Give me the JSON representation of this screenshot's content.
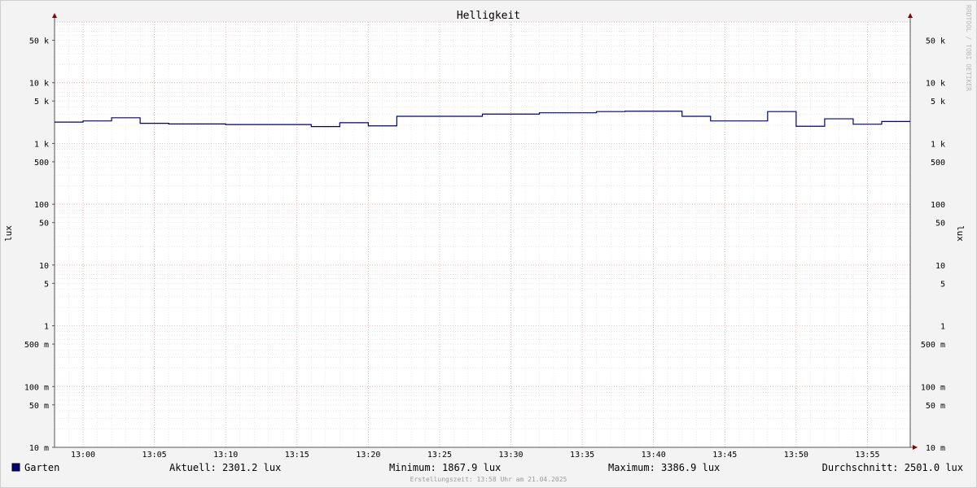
{
  "chart_data": {
    "type": "line",
    "title": "Helligkeit",
    "ylabel": "lux",
    "yscale": "log",
    "ylim": [
      0.01,
      100000
    ],
    "grid": true,
    "y_ticks": [
      {
        "value": 50000,
        "label": "50 k"
      },
      {
        "value": 10000,
        "label": "10 k"
      },
      {
        "value": 5000,
        "label": "5 k"
      },
      {
        "value": 1000,
        "label": "1 k"
      },
      {
        "value": 500,
        "label": "500"
      },
      {
        "value": 100,
        "label": "100"
      },
      {
        "value": 50,
        "label": "50"
      },
      {
        "value": 10,
        "label": "10"
      },
      {
        "value": 5,
        "label": "5"
      },
      {
        "value": 1,
        "label": "1"
      },
      {
        "value": 0.5,
        "label": "500 m"
      },
      {
        "value": 0.1,
        "label": "100 m"
      },
      {
        "value": 0.05,
        "label": "50 m"
      },
      {
        "value": 0.01,
        "label": "10 m"
      }
    ],
    "x_ticks": [
      "13:00",
      "13:05",
      "13:10",
      "13:15",
      "13:20",
      "13:25",
      "13:30",
      "13:35",
      "13:40",
      "13:45",
      "13:50",
      "13:55"
    ],
    "series": [
      {
        "name": "Garten",
        "color": "#000080",
        "points": [
          [
            "12:58",
            2250
          ],
          [
            "13:00",
            2350
          ],
          [
            "13:02",
            2650
          ],
          [
            "13:04",
            2150
          ],
          [
            "13:06",
            2100
          ],
          [
            "13:10",
            2050
          ],
          [
            "13:16",
            1900
          ],
          [
            "13:18",
            2200
          ],
          [
            "13:20",
            1950
          ],
          [
            "13:22",
            2800
          ],
          [
            "13:28",
            3050
          ],
          [
            "13:32",
            3200
          ],
          [
            "13:36",
            3350
          ],
          [
            "13:38",
            3400
          ],
          [
            "13:42",
            2800
          ],
          [
            "13:44",
            2350
          ],
          [
            "13:48",
            3350
          ],
          [
            "13:50",
            1920
          ],
          [
            "13:52",
            2550
          ],
          [
            "13:54",
            2080
          ],
          [
            "13:56",
            2300
          ],
          [
            "13:58",
            2300
          ]
        ]
      }
    ]
  },
  "legend": {
    "series_name": "Garten",
    "swatch_color": "#000080",
    "aktuell": "Aktuell: 2301.2 lux",
    "minimum": "Minimum: 1867.9 lux",
    "maximum": "Maximum: 3386.9 lux",
    "durchschnitt": "Durchschnitt: 2501.0 lux"
  },
  "footer": "Erstellungszeit: 13:58 Uhr am 21.04.2025",
  "watermark": "RRDTOOL / TOBI OETIKER"
}
